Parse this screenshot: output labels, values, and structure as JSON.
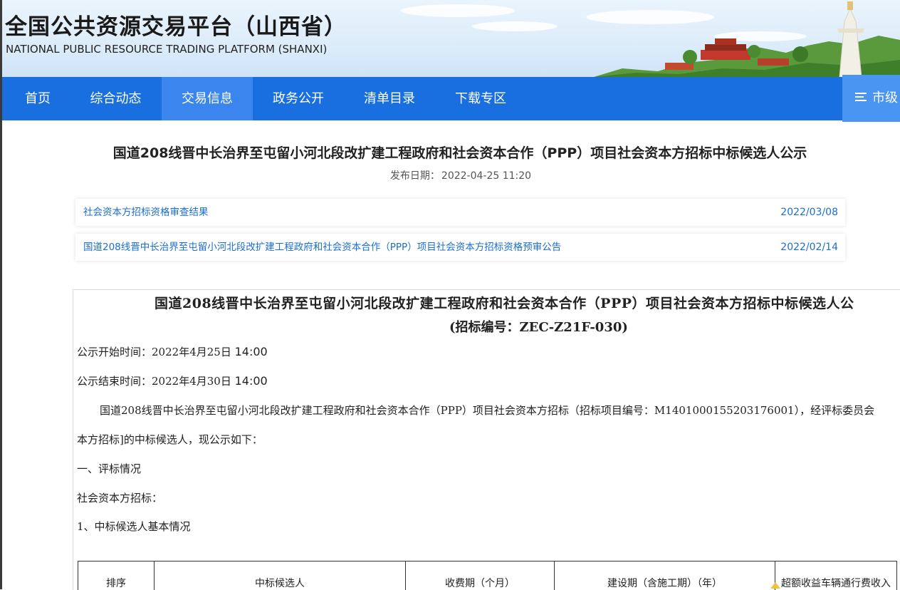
{
  "header": {
    "title": "全国公共资源交易平台（山西省）",
    "subtitle": "NATIONAL PUBLIC RESOURCE TRADING PLATFORM (SHANXI)"
  },
  "nav": {
    "items": [
      {
        "label": "首页"
      },
      {
        "label": "综合动态"
      },
      {
        "label": "交易信息",
        "active": true
      },
      {
        "label": "政务公开"
      },
      {
        "label": "清单目录"
      },
      {
        "label": "下载专区"
      }
    ],
    "right_label": "市级",
    "right_icon": "menu-icon"
  },
  "article": {
    "title": "国道208线晋中长治界至屯留小河北段改扩建工程政府和社会资本合作（PPP）项目社会资本方招标中标候选人公示",
    "publish_label": "发布日期：",
    "publish_date": "2022-04-25 11:20"
  },
  "related": [
    {
      "title": "社会资本方招标资格审查结果",
      "date": "2022/03/08"
    },
    {
      "title": "国道208线晋中长治界至屯留小河北段改扩建工程政府和社会资本合作（PPP）项目社会资本方招标资格预审公告",
      "date": "2022/02/14"
    }
  ],
  "document": {
    "title": "国道208线晋中长治界至屯留小河北段改扩建工程政府和社会资本合作（PPP）项目社会资本方招标中标候选人公",
    "subtitle": "(招标编号：ZEC-Z21F-030)",
    "start_label": "公示开始时间：",
    "start_date": "2022年4月25日",
    "start_time": "14:00",
    "end_label": "公示结束时间：",
    "end_date": "2022年4月30日",
    "end_time": "14:00",
    "paragraph_line1": "国道208线晋中长治界至屯留小河北段改扩建工程政府和社会资本合作（PPP）项目社会资本方招标（招标项目编号：M1401000155203176001），经评标委员会",
    "paragraph_line2": "本方招标]的中标候选人，现公示如下：",
    "section1": "一、评标情况",
    "section1_sub": "社会资本方招标：",
    "section1_item1": "1、中标候选人基本情况",
    "table_headers": [
      "排序",
      "中标候选人",
      "收费期（个月）",
      "建设期（含施工期）（年）",
      "超额收益车辆通行费收入"
    ]
  },
  "colors": {
    "nav_bg": "#1a6fe0",
    "nav_active": "#3a86ee",
    "link": "#1a6fcf"
  }
}
